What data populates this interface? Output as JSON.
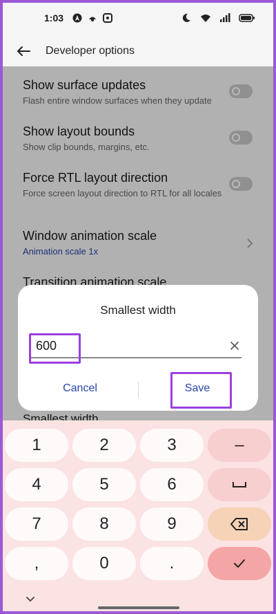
{
  "status_bar": {
    "time": "1:03",
    "left_icons": [
      "navigation-icon",
      "notification-app-icon",
      "screenshot-icon"
    ],
    "right_icons": [
      "moon-icon",
      "wifi-icon",
      "signal-icon",
      "battery-icon"
    ]
  },
  "header": {
    "title": "Developer options"
  },
  "settings": [
    {
      "title": "Show surface updates",
      "subtitle": "Flash entire window surfaces when they update",
      "control": "toggle",
      "value": false
    },
    {
      "title": "Show layout bounds",
      "subtitle": "Show clip bounds, margins, etc.",
      "control": "toggle",
      "value": false
    },
    {
      "title": "Force RTL layout direction",
      "subtitle": "Force screen layout direction to RTL for all locales",
      "control": "toggle",
      "value": false
    },
    {
      "title": "Window animation scale",
      "subtitle": "Animation scale 1x",
      "control": "chevron"
    },
    {
      "title": "Transition animation scale",
      "subtitle": "",
      "control": "chevron"
    }
  ],
  "peek_text": "Smallest width",
  "dialog": {
    "title": "Smallest width",
    "input_value": "600",
    "cancel_label": "Cancel",
    "save_label": "Save"
  },
  "keyboard": {
    "rows": [
      [
        "1",
        "2",
        "3",
        "–"
      ],
      [
        "4",
        "5",
        "6",
        "␣"
      ],
      [
        "7",
        "8",
        "9",
        "⌫"
      ],
      [
        ",",
        "0",
        ".",
        "✓"
      ]
    ]
  },
  "colors": {
    "accent": "#2844a8",
    "highlight": "#9b3fe0",
    "keyboard_bg": "#fbe3e3",
    "ok_key": "#f4a5a5"
  }
}
